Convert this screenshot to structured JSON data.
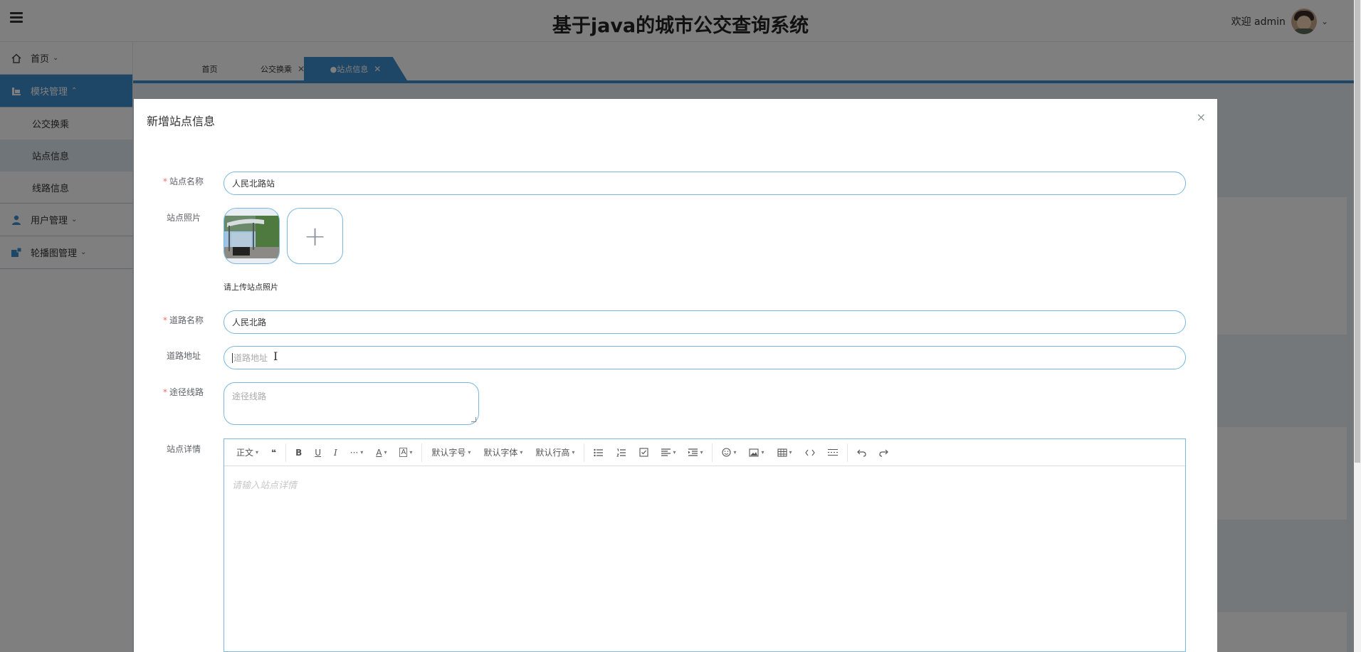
{
  "header": {
    "title": "基于java的城市公交查询系统",
    "welcome": "欢迎 admin",
    "menu_icon": "hamburger-icon",
    "avatar_icon": "user-avatar"
  },
  "sidebar": {
    "items": [
      {
        "label": "首页",
        "icon": "home-icon",
        "chevron": "⌄"
      },
      {
        "label": "模块管理",
        "icon": "module-icon",
        "chevron": "⌃"
      },
      {
        "label": "用户管理",
        "icon": "user-icon",
        "chevron": "⌄"
      },
      {
        "label": "轮播图管理",
        "icon": "carousel-icon",
        "chevron": "⌄"
      }
    ],
    "sub_items": [
      {
        "label": "公交换乘"
      },
      {
        "label": "站点信息"
      },
      {
        "label": "线路信息"
      }
    ]
  },
  "tabs": [
    {
      "label": "首页"
    },
    {
      "label": "公交换乘",
      "close": "✕"
    },
    {
      "label": "●站点信息",
      "close": "✕"
    }
  ],
  "dialog": {
    "title": "新增站点信息",
    "close": "×",
    "fields": {
      "station_name": {
        "label": "站点名称",
        "value": "人民北路站"
      },
      "station_photo": {
        "label": "站点照片",
        "add": "+",
        "tip": "请上传站点照片"
      },
      "road_name": {
        "label": "道路名称",
        "value": "人民北路"
      },
      "road_address": {
        "label": "道路地址",
        "placeholder": "道路地址"
      },
      "routes": {
        "label": "途径线路",
        "placeholder": "途径线路"
      },
      "details": {
        "label": "站点详情",
        "placeholder": "请输入站点详情"
      }
    },
    "toolbar": {
      "paragraph": "正文",
      "quote": "❝",
      "bold": "B",
      "underline": "U",
      "italic": "I",
      "more": "···",
      "font_color": "A",
      "bg_color": "A",
      "font_size": "默认字号",
      "font_family": "默认字体",
      "line_height": "默认行高",
      "dropdown": "▾"
    }
  },
  "colors": {
    "accent": "#3d8fcf",
    "input_border": "#79b8e0",
    "required": "#f56c6c"
  }
}
